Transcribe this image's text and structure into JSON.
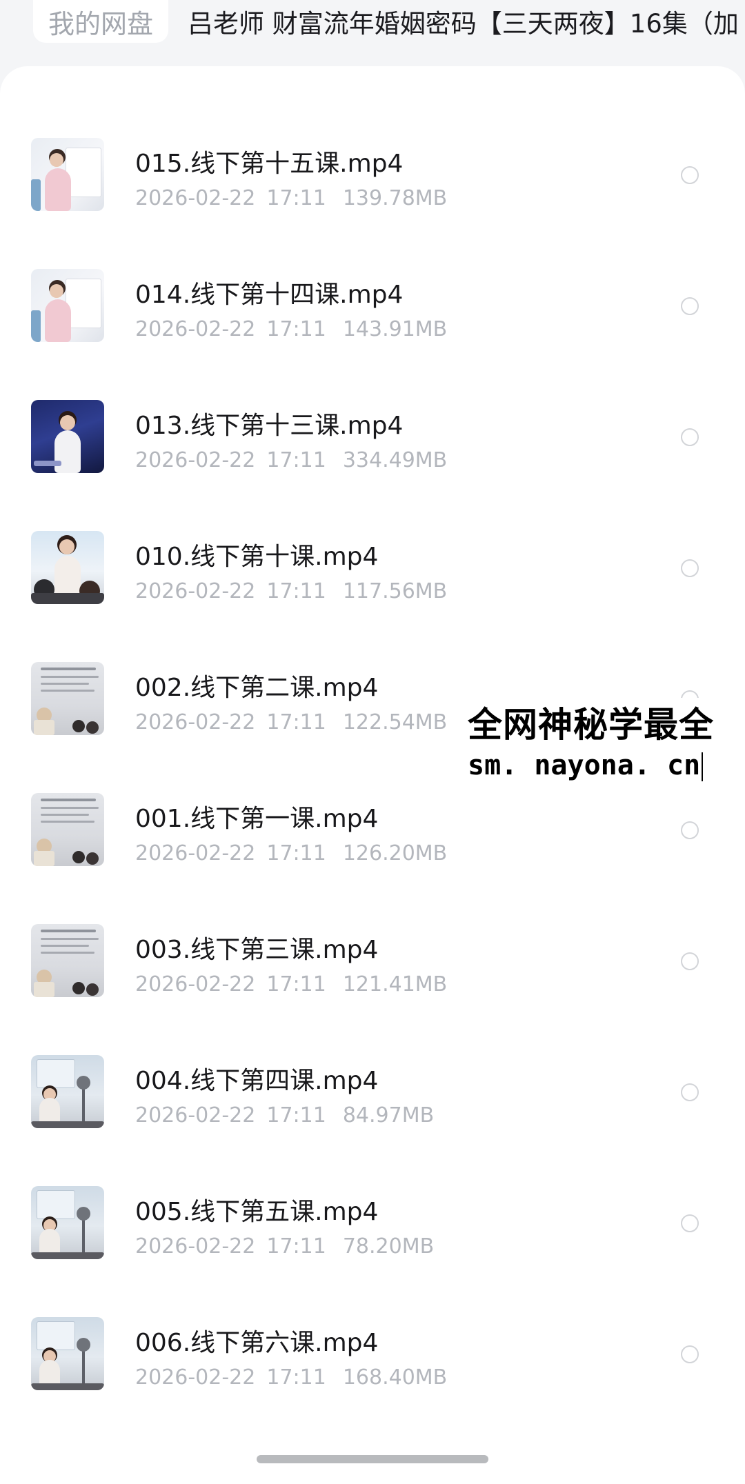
{
  "breadcrumb": {
    "home": "我的网盘",
    "current": "吕老师 财富流年婚姻密码【三天两夜】16集（加"
  },
  "files": [
    {
      "name": "015.线下第十五课.mp4",
      "date": "2026-02-22",
      "time": "17:11",
      "size": "139.78MB",
      "thumb": "thumb-speaker-board-icon"
    },
    {
      "name": "014.线下第十四课.mp4",
      "date": "2026-02-22",
      "time": "17:11",
      "size": "143.91MB",
      "thumb": "thumb-speaker-board-icon"
    },
    {
      "name": "013.线下第十三课.mp4",
      "date": "2026-02-22",
      "time": "17:11",
      "size": "334.49MB",
      "thumb": "thumb-speaker-stage-icon"
    },
    {
      "name": "010.线下第十课.mp4",
      "date": "2026-02-22",
      "time": "17:11",
      "size": "117.56MB",
      "thumb": "thumb-speaker-audience-icon"
    },
    {
      "name": "002.线下第二课.mp4",
      "date": "2026-02-22",
      "time": "17:11",
      "size": "122.54MB",
      "thumb": "thumb-slide-classroom-icon"
    },
    {
      "name": "001.线下第一课.mp4",
      "date": "2026-02-22",
      "time": "17:11",
      "size": "126.20MB",
      "thumb": "thumb-slide-classroom-icon"
    },
    {
      "name": "003.线下第三课.mp4",
      "date": "2026-02-22",
      "time": "17:11",
      "size": "121.41MB",
      "thumb": "thumb-slide-classroom-icon"
    },
    {
      "name": "004.线下第四课.mp4",
      "date": "2026-02-22",
      "time": "17:11",
      "size": "84.97MB",
      "thumb": "thumb-speaker-screen-icon"
    },
    {
      "name": "005.线下第五课.mp4",
      "date": "2026-02-22",
      "time": "17:11",
      "size": "78.20MB",
      "thumb": "thumb-speaker-screen-icon"
    },
    {
      "name": "006.线下第六课.mp4",
      "date": "2026-02-22",
      "time": "17:11",
      "size": "168.40MB",
      "thumb": "thumb-speaker-screen-icon"
    }
  ],
  "watermark": {
    "line1": "全网神秘学最全",
    "line2": "sm. nayona. cn"
  },
  "colors": {
    "background": "#f4f5f7",
    "panel": "#ffffff",
    "title_text": "#18181b",
    "meta_text": "#b3b6bc",
    "radio_border": "#d2d4d8"
  }
}
